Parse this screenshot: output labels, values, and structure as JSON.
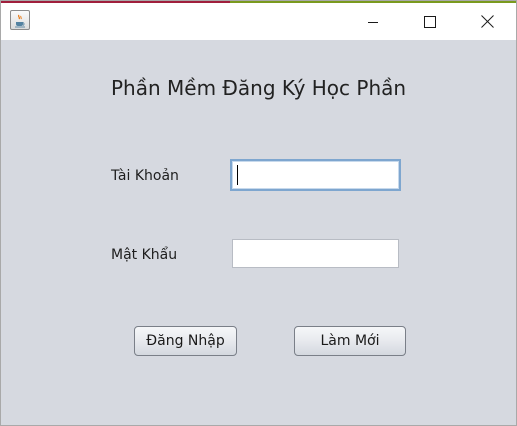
{
  "window": {
    "colors": {
      "accent_left": "#a01f3c",
      "accent_right": "#7a9a1e",
      "background": "#d6d9e0"
    },
    "controls": {
      "minimize_icon": "minimize-icon",
      "maximize_icon": "maximize-icon",
      "close_icon": "close-icon"
    },
    "app_icon": "java-cup-icon"
  },
  "form": {
    "title": "Phần Mềm Đăng Ký Học Phần",
    "username_label": "Tài Khoản",
    "username_value": "",
    "password_label": "Mật Khẩu",
    "password_value": "",
    "login_button": "Đăng Nhập",
    "reset_button": "Làm Mới"
  }
}
